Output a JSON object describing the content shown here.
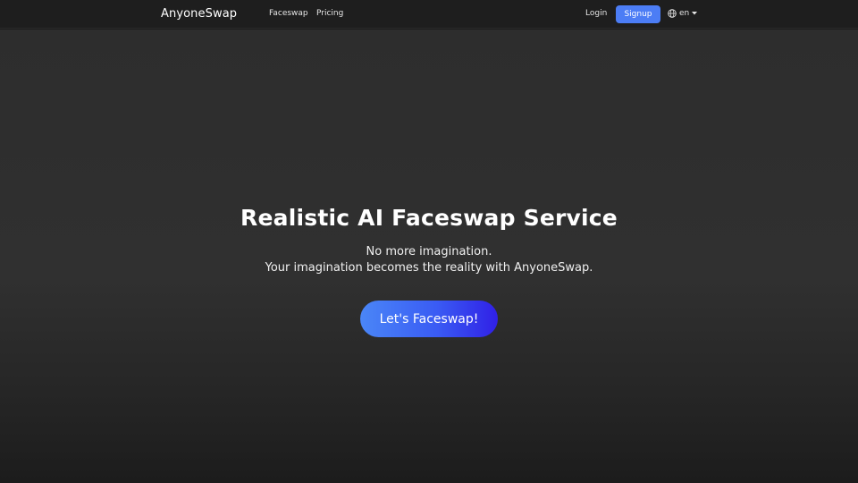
{
  "nav": {
    "brand": "AnyoneSwap",
    "links": [
      {
        "label": "Faceswap"
      },
      {
        "label": "Pricing"
      }
    ],
    "login_label": "Login",
    "signup_label": "Signup",
    "language": {
      "selected": "en",
      "icon": "globe-icon",
      "dropdown_icon": "caret-down-icon"
    }
  },
  "hero": {
    "title": "Realistic AI Faceswap Service",
    "subtitle_line1": "No more imagination.",
    "subtitle_line2": "Your imagination becomes the reality with AnyoneSwap.",
    "cta_label": "Let's Faceswap!"
  },
  "colors": {
    "accent": "#4c7df5",
    "cta_gradient_start": "#4a86f7",
    "cta_gradient_end": "#3020e6",
    "background": "#2d2d2d",
    "navbar": "#1e1e1e"
  }
}
